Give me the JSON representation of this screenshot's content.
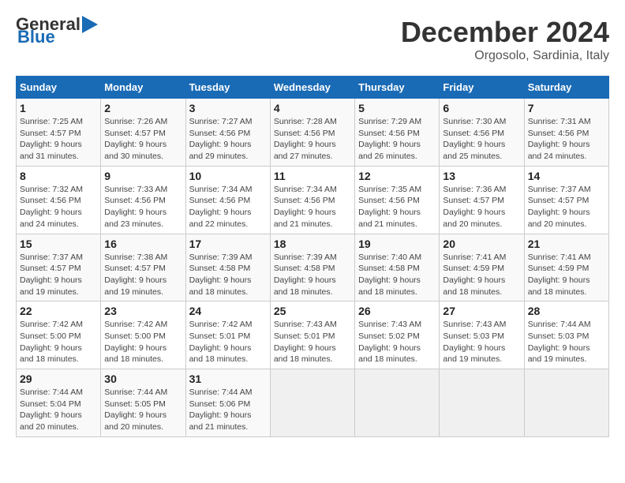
{
  "header": {
    "logo_line1": "General",
    "logo_line2": "Blue",
    "month": "December 2024",
    "location": "Orgosolo, Sardinia, Italy"
  },
  "weekdays": [
    "Sunday",
    "Monday",
    "Tuesday",
    "Wednesday",
    "Thursday",
    "Friday",
    "Saturday"
  ],
  "weeks": [
    [
      {
        "day": "1",
        "detail": "Sunrise: 7:25 AM\nSunset: 4:57 PM\nDaylight: 9 hours and 31 minutes."
      },
      {
        "day": "2",
        "detail": "Sunrise: 7:26 AM\nSunset: 4:57 PM\nDaylight: 9 hours and 30 minutes."
      },
      {
        "day": "3",
        "detail": "Sunrise: 7:27 AM\nSunset: 4:56 PM\nDaylight: 9 hours and 29 minutes."
      },
      {
        "day": "4",
        "detail": "Sunrise: 7:28 AM\nSunset: 4:56 PM\nDaylight: 9 hours and 27 minutes."
      },
      {
        "day": "5",
        "detail": "Sunrise: 7:29 AM\nSunset: 4:56 PM\nDaylight: 9 hours and 26 minutes."
      },
      {
        "day": "6",
        "detail": "Sunrise: 7:30 AM\nSunset: 4:56 PM\nDaylight: 9 hours and 25 minutes."
      },
      {
        "day": "7",
        "detail": "Sunrise: 7:31 AM\nSunset: 4:56 PM\nDaylight: 9 hours and 24 minutes."
      }
    ],
    [
      {
        "day": "8",
        "detail": "Sunrise: 7:32 AM\nSunset: 4:56 PM\nDaylight: 9 hours and 24 minutes."
      },
      {
        "day": "9",
        "detail": "Sunrise: 7:33 AM\nSunset: 4:56 PM\nDaylight: 9 hours and 23 minutes."
      },
      {
        "day": "10",
        "detail": "Sunrise: 7:34 AM\nSunset: 4:56 PM\nDaylight: 9 hours and 22 minutes."
      },
      {
        "day": "11",
        "detail": "Sunrise: 7:34 AM\nSunset: 4:56 PM\nDaylight: 9 hours and 21 minutes."
      },
      {
        "day": "12",
        "detail": "Sunrise: 7:35 AM\nSunset: 4:56 PM\nDaylight: 9 hours and 21 minutes."
      },
      {
        "day": "13",
        "detail": "Sunrise: 7:36 AM\nSunset: 4:57 PM\nDaylight: 9 hours and 20 minutes."
      },
      {
        "day": "14",
        "detail": "Sunrise: 7:37 AM\nSunset: 4:57 PM\nDaylight: 9 hours and 20 minutes."
      }
    ],
    [
      {
        "day": "15",
        "detail": "Sunrise: 7:37 AM\nSunset: 4:57 PM\nDaylight: 9 hours and 19 minutes."
      },
      {
        "day": "16",
        "detail": "Sunrise: 7:38 AM\nSunset: 4:57 PM\nDaylight: 9 hours and 19 minutes."
      },
      {
        "day": "17",
        "detail": "Sunrise: 7:39 AM\nSunset: 4:58 PM\nDaylight: 9 hours and 18 minutes."
      },
      {
        "day": "18",
        "detail": "Sunrise: 7:39 AM\nSunset: 4:58 PM\nDaylight: 9 hours and 18 minutes."
      },
      {
        "day": "19",
        "detail": "Sunrise: 7:40 AM\nSunset: 4:58 PM\nDaylight: 9 hours and 18 minutes."
      },
      {
        "day": "20",
        "detail": "Sunrise: 7:41 AM\nSunset: 4:59 PM\nDaylight: 9 hours and 18 minutes."
      },
      {
        "day": "21",
        "detail": "Sunrise: 7:41 AM\nSunset: 4:59 PM\nDaylight: 9 hours and 18 minutes."
      }
    ],
    [
      {
        "day": "22",
        "detail": "Sunrise: 7:42 AM\nSunset: 5:00 PM\nDaylight: 9 hours and 18 minutes."
      },
      {
        "day": "23",
        "detail": "Sunrise: 7:42 AM\nSunset: 5:00 PM\nDaylight: 9 hours and 18 minutes."
      },
      {
        "day": "24",
        "detail": "Sunrise: 7:42 AM\nSunset: 5:01 PM\nDaylight: 9 hours and 18 minutes."
      },
      {
        "day": "25",
        "detail": "Sunrise: 7:43 AM\nSunset: 5:01 PM\nDaylight: 9 hours and 18 minutes."
      },
      {
        "day": "26",
        "detail": "Sunrise: 7:43 AM\nSunset: 5:02 PM\nDaylight: 9 hours and 18 minutes."
      },
      {
        "day": "27",
        "detail": "Sunrise: 7:43 AM\nSunset: 5:03 PM\nDaylight: 9 hours and 19 minutes."
      },
      {
        "day": "28",
        "detail": "Sunrise: 7:44 AM\nSunset: 5:03 PM\nDaylight: 9 hours and 19 minutes."
      }
    ],
    [
      {
        "day": "29",
        "detail": "Sunrise: 7:44 AM\nSunset: 5:04 PM\nDaylight: 9 hours and 20 minutes."
      },
      {
        "day": "30",
        "detail": "Sunrise: 7:44 AM\nSunset: 5:05 PM\nDaylight: 9 hours and 20 minutes."
      },
      {
        "day": "31",
        "detail": "Sunrise: 7:44 AM\nSunset: 5:06 PM\nDaylight: 9 hours and 21 minutes."
      },
      null,
      null,
      null,
      null
    ]
  ]
}
